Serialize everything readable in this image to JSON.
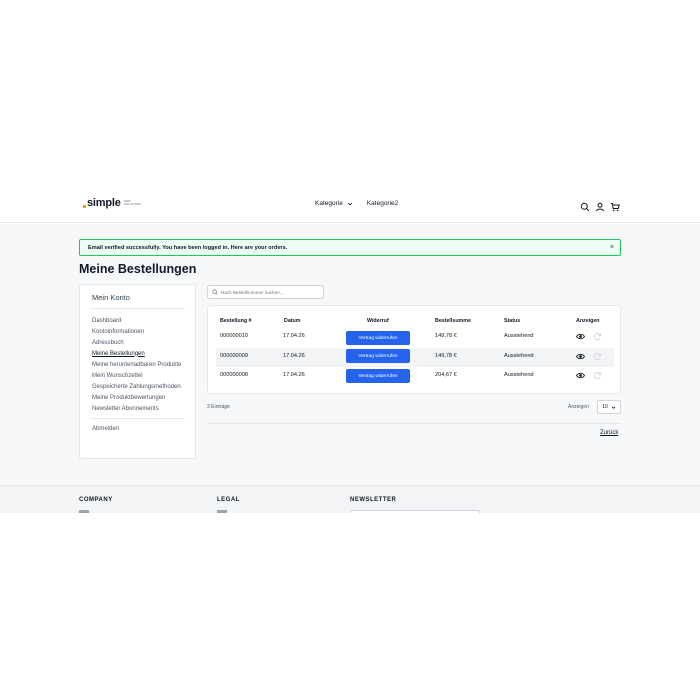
{
  "header": {
    "logo_text": "simple",
    "logo_sub": "Web Solutions",
    "nav": [
      {
        "label": "Kategorie",
        "has_dropdown": true
      },
      {
        "label": "Kategorie2",
        "has_dropdown": false
      }
    ],
    "icons": [
      "search-icon",
      "user-icon",
      "cart-icon"
    ]
  },
  "alert": {
    "message": "Email verified successfully. You have been logged in. Here are your orders.",
    "close": "×"
  },
  "page": {
    "title": "Meine Bestellungen"
  },
  "sidebar": {
    "title": "Mein Konto",
    "items": [
      {
        "label": "Dashboard"
      },
      {
        "label": "Kontoinformationen"
      },
      {
        "label": "Adressbuch"
      },
      {
        "label": "Meine Bestellungen",
        "active": true
      },
      {
        "label": "Meine herunterladbaren Produkte"
      },
      {
        "label": "Mein Wunschzettel"
      },
      {
        "label": "Gespeicherte Zahlungsmethoden"
      },
      {
        "label": "Meine Produktbewertungen"
      },
      {
        "label": "Newsletter Abonnements"
      }
    ],
    "logout": "Abmelden"
  },
  "search": {
    "placeholder": "Nach Bestellnummer suchen..."
  },
  "table": {
    "headers": [
      "Bestellung #",
      "Datum",
      "Widerruf",
      "Bestellsumme",
      "Status",
      "Anzeigen"
    ],
    "rows": [
      {
        "order": "000000010",
        "date": "17.04.26",
        "revoke": "Vertrag widerrufen",
        "total": "149,78 €",
        "status": "Ausstehend"
      },
      {
        "order": "000000009",
        "date": "17.04.26",
        "revoke": "Vertrag widerrufen",
        "total": "149,78 €",
        "status": "Ausstehend"
      },
      {
        "order": "000000008",
        "date": "17.04.26",
        "revoke": "Vertrag widerrufen",
        "total": "204,67 €",
        "status": "Ausstehend"
      }
    ]
  },
  "pagination": {
    "count": "3 Einträge",
    "perpage_label": "Anzeigen",
    "perpage_value": "10"
  },
  "back_link": "Zurück",
  "footer": {
    "columns": [
      "COMPANY",
      "LEGAL",
      "NEWSLETTER"
    ]
  },
  "colors": {
    "accent": "#2563eb",
    "success_border": "#22c55e",
    "success_bg": "#ecfdf3",
    "logo_dot": "#f59e0b"
  }
}
